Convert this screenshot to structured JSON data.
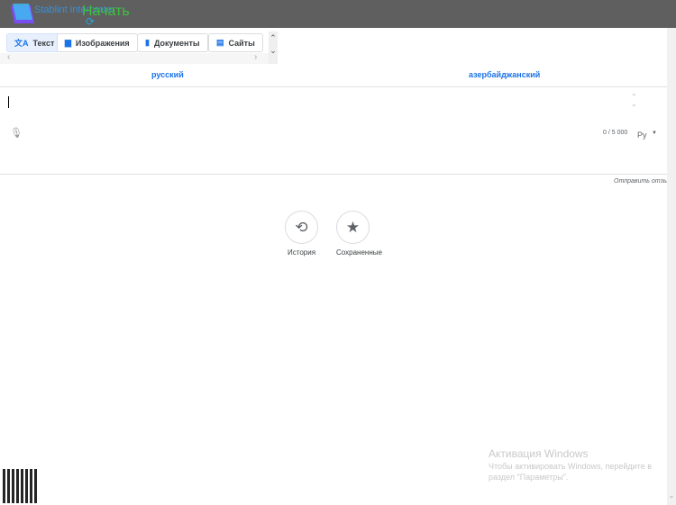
{
  "header": {
    "logo_text": "Stablint interpreter",
    "start_label": "Начать",
    "reload_icon": "reload-icon"
  },
  "tabs": [
    {
      "label": "Текст",
      "icon": "translate-icon",
      "active": true
    },
    {
      "label": "Изображения",
      "icon": "image-icon"
    },
    {
      "label": "Документы",
      "icon": "document-icon"
    },
    {
      "label": "Сайты",
      "icon": "website-icon"
    }
  ],
  "languages": {
    "source": "русский",
    "target": "азербайджанский"
  },
  "input": {
    "char_count": "0 / 5 000",
    "input_tool": "Ру"
  },
  "feedback": "Отправить отзыв",
  "actions": [
    {
      "label": "История",
      "icon": "history-icon"
    },
    {
      "label": "Сохраненные",
      "icon": "star-icon"
    }
  ],
  "watermark": {
    "title": "Активация Windows",
    "text": "Чтобы активировать Windows, перейдите в раздел \"Параметры\"."
  }
}
